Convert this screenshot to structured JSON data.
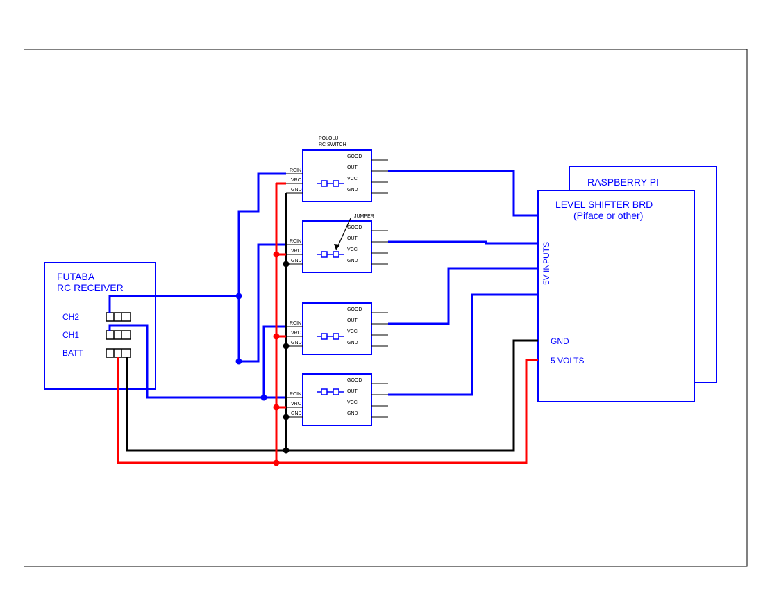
{
  "title": {
    "line1": "POLOLU",
    "line2": "RC SWITCH"
  },
  "receiver": {
    "title1": "FUTABA",
    "title2": "RC RECEIVER",
    "ch2": "CH2",
    "ch1": "CH1",
    "batt": "BATT"
  },
  "switch": {
    "rcin": "RCIN",
    "vrc": "VRC",
    "gnd": "GND",
    "good": "GOOD",
    "out": "OUT",
    "vcc": "VCC",
    "gnd_r": "GND"
  },
  "jumper": "JUMPER",
  "rpi": {
    "title": "RASPBERRY PI"
  },
  "shifter": {
    "title1": "LEVEL SHIFTER BRD",
    "title2": "(Piface or other)",
    "inputs": "5V INPUTS",
    "gnd": "GND",
    "volts": "5 VOLTS"
  },
  "colors": {
    "blue": "#0000FF",
    "black": "#000000",
    "red": "#FF0000"
  }
}
